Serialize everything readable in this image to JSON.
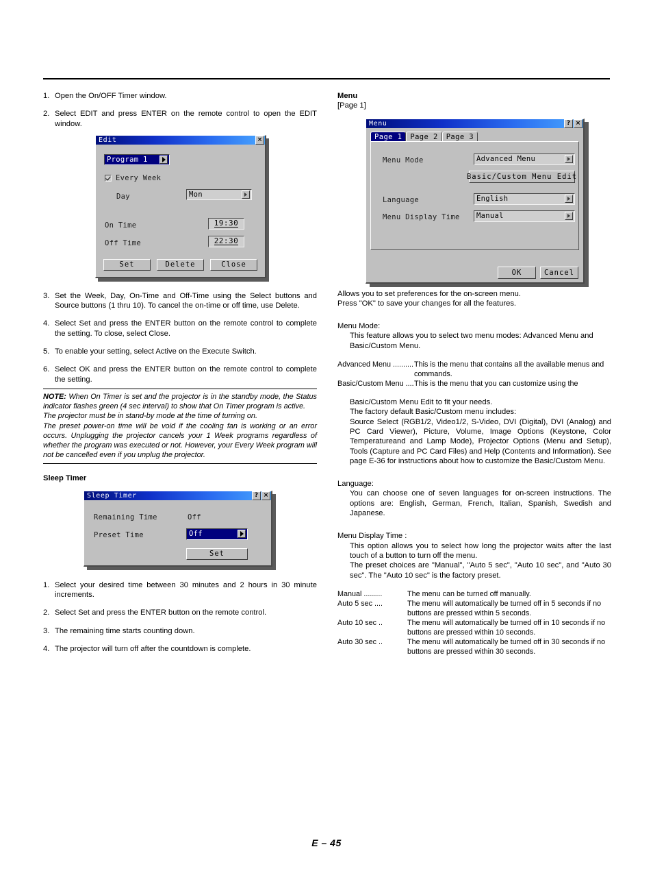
{
  "footer": {
    "page_label": "E – 45"
  },
  "left": {
    "steps_top": [
      {
        "num": "1.",
        "text": "Open the On/OFF Timer window."
      },
      {
        "num": "2.",
        "text": "Select EDIT and press ENTER on the remote control to open the EDIT window."
      }
    ],
    "edit_dialog": {
      "title": "Edit",
      "close_label": "×",
      "program_value": "Program 1",
      "every_week_label": "Every Week",
      "day_label": "Day",
      "day_value": "Mon",
      "on_time_label": "On Time",
      "on_time_value": "19:30",
      "off_time_label": "Off Time",
      "off_time_value": "22:30",
      "set_label": "Set",
      "delete_label": "Delete",
      "close_button_label": "Close"
    },
    "steps_bottom": [
      {
        "num": "3.",
        "text": "Set the Week, Day, On-Time and Off-Time using the Select buttons and Source buttons (1 thru 10). To cancel the on-time or off time, use Delete."
      },
      {
        "num": "4.",
        "text": "Select Set and press the ENTER button on the remote control to complete the setting. To close, select Close."
      },
      {
        "num": "5.",
        "text": "To enable your setting, select Active on the Execute Switch."
      },
      {
        "num": "6.",
        "text": "Select OK and press the ENTER button on the remote control to complete the setting."
      }
    ],
    "note": {
      "lead": "NOTE:",
      "p1": " When On Timer is set and the projector is in the standby mode, the Status indicator flashes green (4 sec interval) to show that On Timer program is active.",
      "p2": "The projector must be in stand-by mode at the time of turning on.",
      "p3": "The preset power-on time will be void if the cooling fan is working or an error occurs. Unplugging the projector cancels your 1 Week programs regardless of whether the program was executed or not. However, your Every Week program will not be cancelled even if you unplug the projector."
    },
    "sleep_timer_heading": "Sleep Timer",
    "sleep_dialog": {
      "title": "Sleep Timer",
      "help_label": "?",
      "close_label": "×",
      "remaining_time_label": "Remaining Time",
      "remaining_time_value": "Off",
      "preset_time_label": "Preset Time",
      "preset_time_value": "Off",
      "set_label": "Set"
    },
    "sleep_steps": [
      {
        "num": "1.",
        "text": "Select your desired time between 30 minutes and 2 hours in 30 minute increments."
      },
      {
        "num": "2.",
        "text": "Select Set and press the ENTER button on the remote control."
      },
      {
        "num": "3.",
        "text": "The remaining time starts counting down."
      },
      {
        "num": "4.",
        "text": "The projector will turn off after the countdown is complete."
      }
    ]
  },
  "right": {
    "heading": "Menu",
    "subheading": "[Page 1]",
    "menu_dialog": {
      "title": "Menu",
      "help_label": "?",
      "close_label": "×",
      "tabs": [
        {
          "label": "Page 1",
          "active": true
        },
        {
          "label": "Page 2",
          "active": false
        },
        {
          "label": "Page 3",
          "active": false
        }
      ],
      "menu_mode_label": "Menu Mode",
      "menu_mode_value": "Advanced Menu",
      "basic_custom_edit_label": "Basic/Custom Menu Edit",
      "language_label": "Language",
      "language_value": "English",
      "menu_display_time_label": "Menu Display Time",
      "menu_display_time_value": "Manual",
      "ok_label": "OK",
      "cancel_label": "Cancel"
    },
    "intro1": "Allows you to set preferences for the on-screen menu.",
    "intro2": "Press \"OK\" to save your changes for all the features.",
    "menu_mode": {
      "heading": "Menu Mode:",
      "body": "This feature allows you to select two menu modes: Advanced Menu and Basic/Custom Menu.",
      "defs": [
        {
          "term": "Advanced Menu ..........",
          "desc": "This is the menu that contains all the available menus and commands."
        },
        {
          "term": "Basic/Custom Menu ....",
          "desc": "This is the menu that you can customize using the"
        }
      ],
      "cont1": "Basic/Custom Menu Edit to fit your needs.",
      "cont2": "The factory default Basic/Custom menu includes:",
      "cont3": "Source Select (RGB1/2, Video1/2, S-Video, DVI (Digital), DVI (Analog) and PC Card Viewer), Picture, Volume, Image Options (Keystone, Color Temperatureand and Lamp Mode), Projector Options (Menu and Setup), Tools (Capture and PC Card Files) and Help (Contents and Information). See page E-36 for instructions about how to customize the Basic/Custom Menu."
    },
    "language": {
      "heading": "Language:",
      "body": "You can choose one of seven languages for on-screen instructions. The options are: English, German, French, Italian, Spanish, Swedish and Japanese."
    },
    "menu_display_time": {
      "heading": "Menu Display Time :",
      "body1": "This option allows you to select how long the projector waits after the last touch of a button to turn off the menu.",
      "body2": "The preset choices are \"Manual\", \"Auto 5 sec\", \"Auto 10 sec\", and \"Auto 30 sec\". The \"Auto 10 sec\" is the factory preset.",
      "defs": [
        {
          "term": "Manual .........",
          "desc": "The menu can be turned off manually."
        },
        {
          "term": "Auto 5 sec ....",
          "desc": "The menu will automatically be turned off in 5 seconds if no buttons are pressed within 5 seconds."
        },
        {
          "term": "Auto 10 sec ..",
          "desc": "The menu will automatically be turned off in 10 seconds if no buttons are pressed within 10 seconds."
        },
        {
          "term": "Auto 30 sec ..",
          "desc": "The menu will automatically be turned off in 30 seconds if no buttons are pressed within 30 seconds."
        }
      ]
    }
  }
}
